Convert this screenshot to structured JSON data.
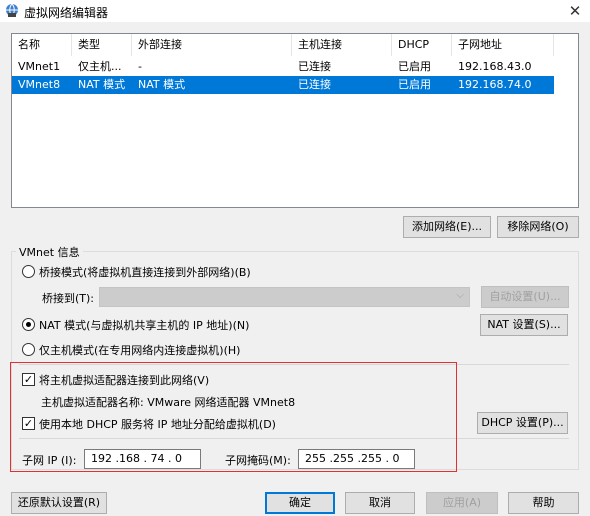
{
  "window": {
    "title": "虚拟网络编辑器",
    "close": "✕"
  },
  "list": {
    "columns": [
      "名称",
      "类型",
      "外部连接",
      "主机连接",
      "DHCP",
      "子网地址"
    ],
    "rows": [
      {
        "name": "VMnet1",
        "type": "仅主机...",
        "external": "-",
        "host": "已连接",
        "dhcp": "已启用",
        "subnet": "192.168.43.0",
        "selected": false
      },
      {
        "name": "VMnet8",
        "type": "NAT 模式",
        "external": "NAT 模式",
        "host": "已连接",
        "dhcp": "已启用",
        "subnet": "192.168.74.0",
        "selected": true
      }
    ]
  },
  "buttons": {
    "add": "添加网络(E)...",
    "remove": "移除网络(O)",
    "auto": "自动设置(U)...",
    "nat": "NAT 设置(S)...",
    "dhcp": "DHCP 设置(P)...",
    "restore": "还原默认设置(R)",
    "ok": "确定",
    "cancel": "取消",
    "apply": "应用(A)",
    "help": "帮助"
  },
  "info": {
    "legend": "VMnet 信息",
    "bridged": "桥接模式(将虚拟机直接连接到外部网络)(B)",
    "bridge_to": "桥接到(T):",
    "nat": "NAT 模式(与虚拟机共享主机的 IP 地址)(N)",
    "hostonly": "仅主机模式(在专用网络内连接虚拟机)(H)",
    "connect_adapter": "将主机虚拟适配器连接到此网络(V)",
    "adapter_name": "主机虚拟适配器名称: VMware 网络适配器 VMnet8",
    "use_dhcp": "使用本地 DHCP 服务将 IP 地址分配给虚拟机(D)",
    "subnet_ip_label": "子网 IP (I):",
    "subnet_ip": "192 .168 . 74 . 0",
    "mask_label": "子网掩码(M):",
    "mask": "255 .255 .255 . 0"
  },
  "state": {
    "mode": "nat",
    "connect_adapter": true,
    "use_dhcp": true
  }
}
